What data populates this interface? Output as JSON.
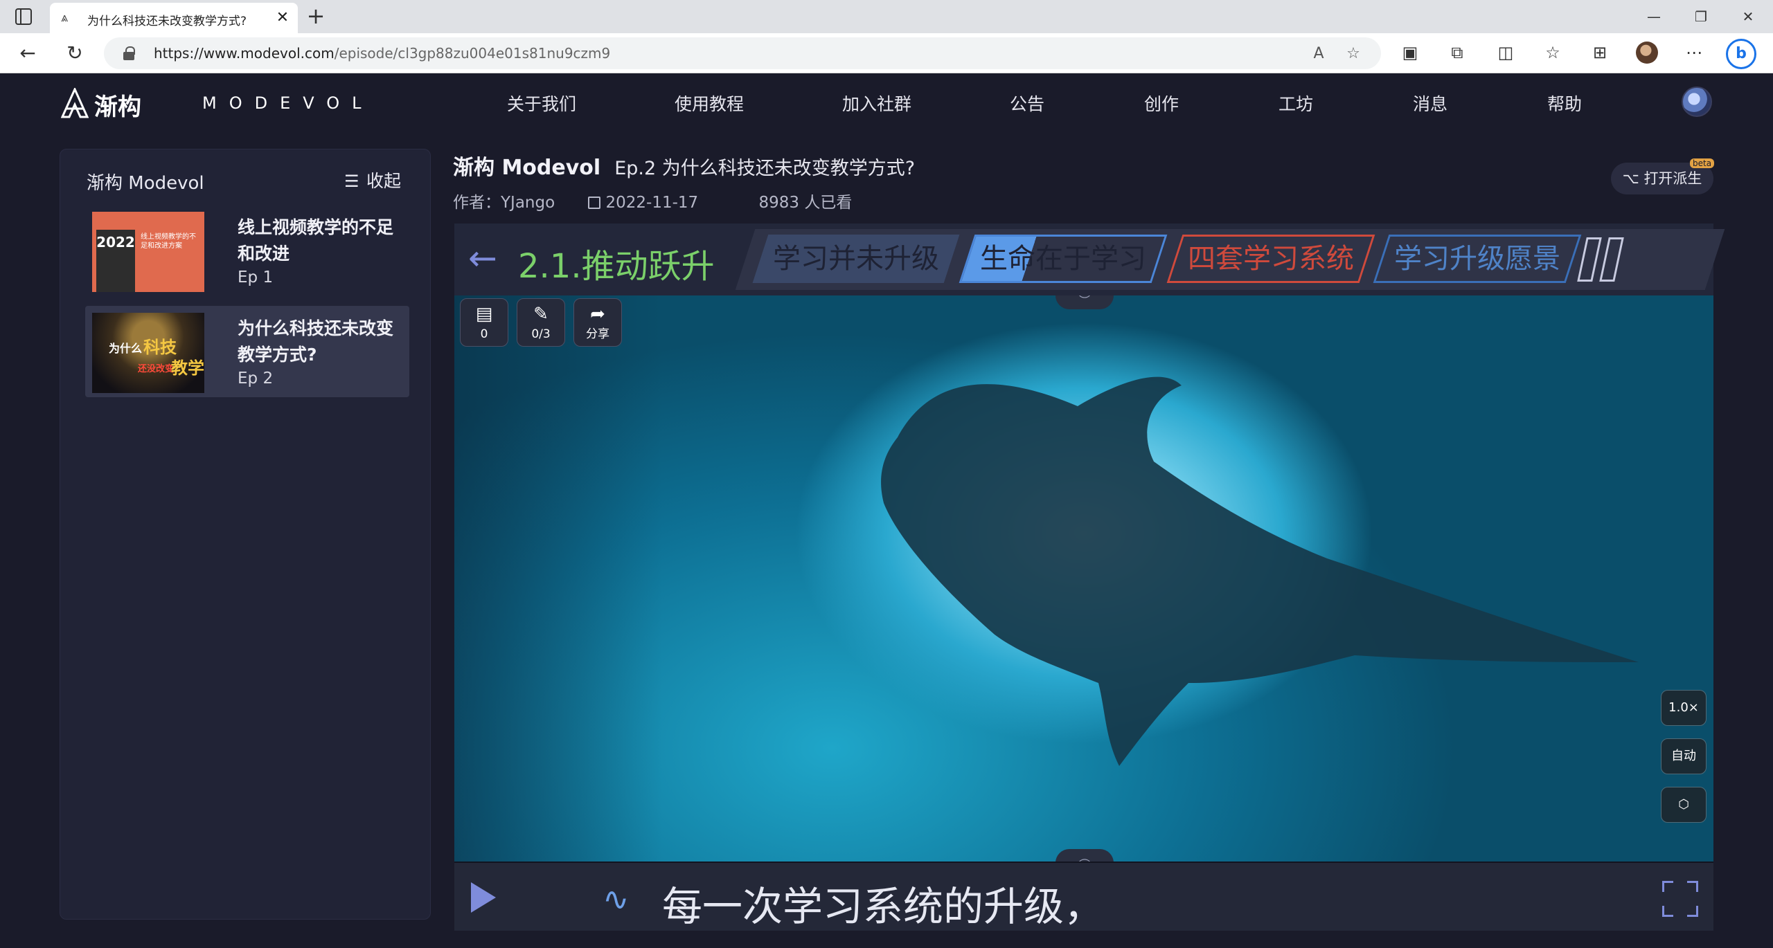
{
  "browser": {
    "tab_title": "为什么科技还未改变教学方式?",
    "new_tab": "+",
    "close_tab": "✕",
    "url_domain": "https://www.modevol.com",
    "url_path": "/episode/cl3gp88zu004e01s81nu9czm9",
    "window_min": "—",
    "window_max": "❐",
    "window_close": "✕"
  },
  "site": {
    "brand_cn": "渐构",
    "brand_en": "MODEVOL",
    "nav": [
      "关于我们",
      "使用教程",
      "加入社群",
      "公告",
      "创作",
      "工坊",
      "消息",
      "帮助"
    ]
  },
  "sidebar": {
    "title": "渐构 Modevol",
    "collapse_label": "收起",
    "episodes": [
      {
        "title": "线上视频教学的不足和改进",
        "ep": "Ep 1",
        "thumb_year": "2022",
        "thumb_text": "线上视频教学的不足和改进方案"
      },
      {
        "title": "为什么科技还未改变教学方式?",
        "ep": "Ep 2",
        "thumb_a": "为什么",
        "thumb_b": "科技",
        "thumb_c": "还没改变",
        "thumb_d": "教学"
      }
    ]
  },
  "episode": {
    "series": "渐构 Modevol",
    "title": "Ep.2 为什么科技还未改变教学方式?",
    "author": "作者：YJango",
    "date": "2022-11-17",
    "views": "8983 人已看",
    "fork_button": "打开派生",
    "beta": "beta"
  },
  "chapter": {
    "title": "2.1.推动跃升",
    "tags": [
      "学习并未升级",
      "生命在于学习",
      "四套学习系统",
      "学习升级愿景"
    ]
  },
  "video": {
    "comments_count": "0",
    "notes_count": "0/3",
    "share_label": "分享",
    "speed": "1.0×",
    "quality": "自动",
    "subtitle": "每一次学习系统的升级，"
  }
}
